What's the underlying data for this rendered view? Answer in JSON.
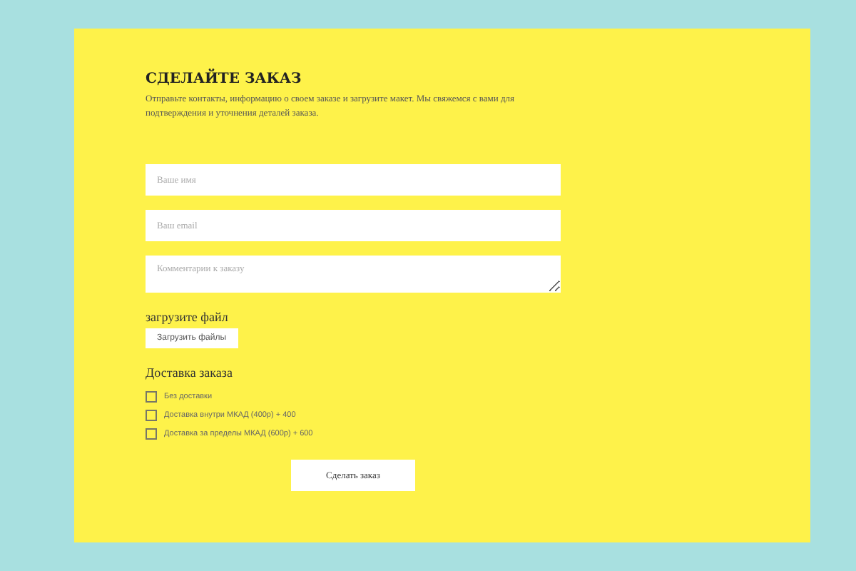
{
  "form": {
    "title": "СДЕЛАЙТЕ ЗАКАЗ",
    "description": "Отправьте контакты, информацию о своем заказе и загрузите макет. Мы свяжемся с вами для подтверждения и уточнения деталей заказа.",
    "fields": [
      {
        "kind": "input",
        "placeholder": "Ваше имя"
      },
      {
        "kind": "input",
        "placeholder": "Ваш email"
      },
      {
        "kind": "textarea",
        "placeholder": "Комментарии к заказу"
      }
    ],
    "upload": {
      "label": "загрузите файл",
      "button": "Загрузить файлы"
    },
    "delivery": {
      "title": "Доставка заказа",
      "options": [
        {
          "label": "Без доставки",
          "checked": false
        },
        {
          "label": "Доставка внутри МКАД (400р) + 400",
          "checked": false
        },
        {
          "label": "Доставка за пределы МКАД (600р) + 600",
          "checked": false
        }
      ]
    },
    "submit": "Сделать заказ"
  }
}
